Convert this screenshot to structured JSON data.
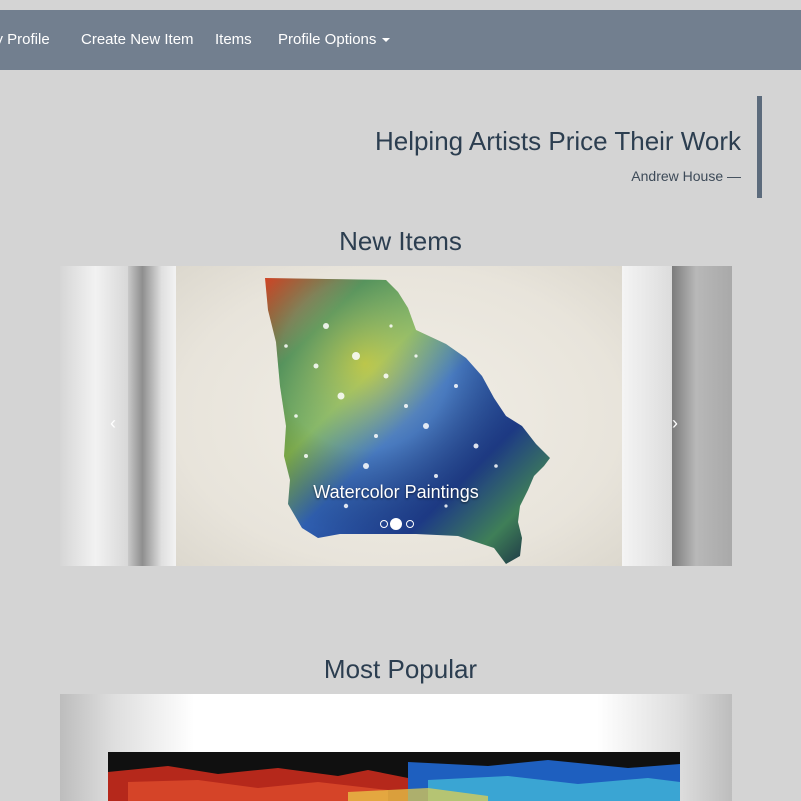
{
  "nav": {
    "items": [
      {
        "label": "My Profile"
      },
      {
        "label": "Create New Item"
      },
      {
        "label": "Items"
      },
      {
        "label": "Profile Options"
      }
    ]
  },
  "quote": {
    "text": "Helping Artists Price Their Work",
    "author": "Andrew House —"
  },
  "sections": {
    "new_items": {
      "title": "New Items",
      "caption": "Watercolor Paintings",
      "prev_icon": "chevron-left-icon",
      "next_icon": "chevron-right-icon",
      "slide_count": 3,
      "active_slide": 2
    },
    "most_popular": {
      "title": "Most Popular"
    }
  },
  "colors": {
    "background": "#d4d4d4",
    "navbar": "#727f8f",
    "quote_border": "#5c6b7c",
    "text": "#2c3e50"
  }
}
